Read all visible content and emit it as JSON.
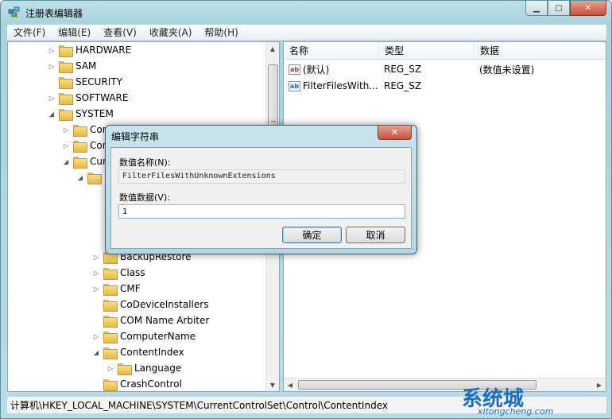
{
  "window": {
    "title": "注册表编辑器",
    "caption_buttons": [
      "▁",
      "▢",
      "✕"
    ]
  },
  "menu": [
    "文件(F)",
    "编辑(E)",
    "查看(V)",
    "收藏夹(A)",
    "帮助(H)"
  ],
  "tree": {
    "items": [
      {
        "label": "HARDWARE",
        "expander": "▷"
      },
      {
        "label": "SAM",
        "expander": "▷"
      },
      {
        "label": "SECURITY",
        "expander": ""
      },
      {
        "label": "SOFTWARE",
        "expander": "▷"
      },
      {
        "label": "SYSTEM",
        "expander": "◢"
      },
      {
        "label": "Con",
        "expander": "▷"
      },
      {
        "label": "Cor",
        "expander": "▷"
      },
      {
        "label": "Cur",
        "expander": "◢"
      },
      {
        "label": "",
        "expander": "◢"
      },
      {
        "label": "BackupRestore",
        "expander": "▷"
      },
      {
        "label": "Class",
        "expander": "▷"
      },
      {
        "label": "CMF",
        "expander": "▷"
      },
      {
        "label": "CoDeviceInstallers",
        "expander": ""
      },
      {
        "label": "COM Name Arbiter",
        "expander": ""
      },
      {
        "label": "ComputerName",
        "expander": "▷"
      },
      {
        "label": "ContentIndex",
        "expander": "◢"
      },
      {
        "label": "Language",
        "expander": "▷"
      },
      {
        "label": "CrashControl",
        "expander": ""
      }
    ]
  },
  "list": {
    "columns": [
      "名称",
      "类型",
      "数据"
    ],
    "rows": [
      {
        "icon": "ab",
        "name": "(默认)",
        "type": "REG_SZ",
        "data": "(数值未设置)"
      },
      {
        "icon": "ab",
        "name": "FilterFilesWith...",
        "type": "REG_SZ",
        "data": ""
      }
    ]
  },
  "status": "计算机\\HKEY_LOCAL_MACHINE\\SYSTEM\\CurrentControlSet\\Control\\ContentIndex",
  "dialog": {
    "title": "编辑字符串",
    "close": "✕",
    "name_label": "数值名称(N):",
    "name_value": "FilterFilesWithUnknownExtensions",
    "data_label": "数值数据(V):",
    "data_value": "1",
    "ok": "确定",
    "cancel": "取消"
  },
  "watermark": {
    "logo": "系统城",
    "site": "xitongcheng.com"
  }
}
